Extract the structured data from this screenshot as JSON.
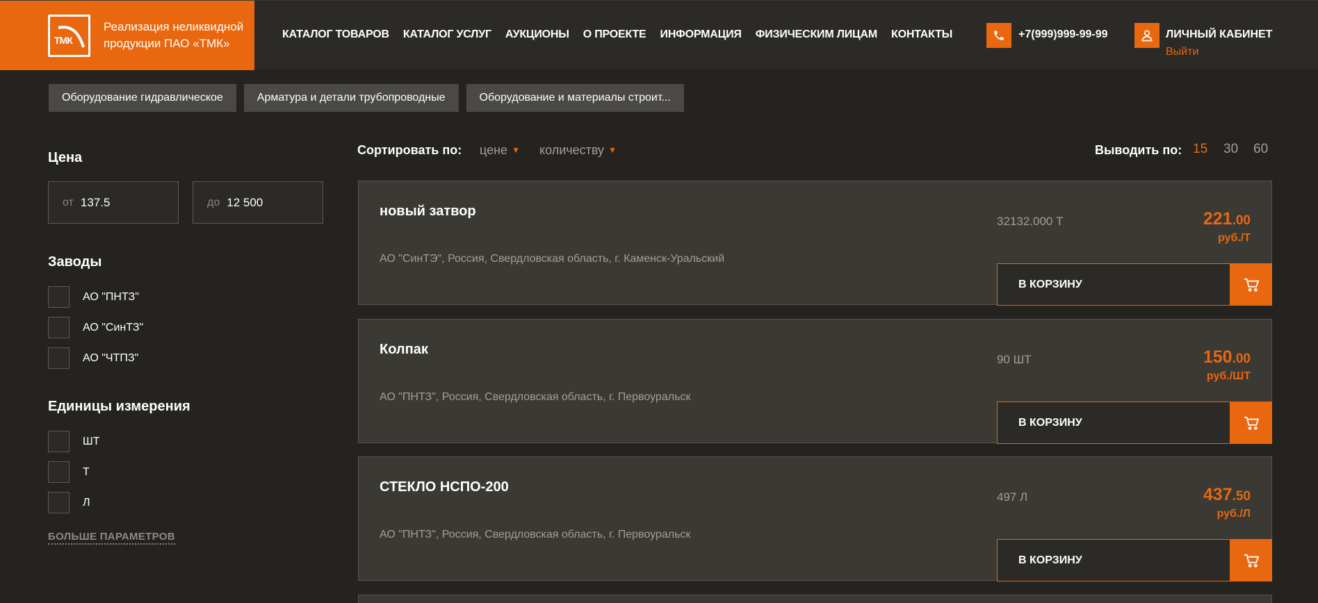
{
  "header": {
    "logo_letters": "ТМК",
    "logo_text": "Реализация неликвидной продукции ПАО «ТМК»",
    "nav": [
      "КАТАЛОГ ТОВАРОВ",
      "КАТАЛОГ УСЛУГ",
      "АУКЦИОНЫ",
      "О ПРОЕКТЕ",
      "ИНФОРМАЦИЯ",
      "ФИЗИЧЕСКИМ ЛИЦАМ",
      "КОНТАКТЫ"
    ],
    "phone": "+7(999)999-99-99",
    "cabinet_label": "ЛИЧНЫЙ КАБИНЕТ",
    "logout_label": "Выйти",
    "phone_icon": "phone-icon",
    "user_icon": "user-icon"
  },
  "chips": [
    "Оборудование гидравлическое",
    "Арматура и детали трубопроводные",
    "Оборудование и материалы строит..."
  ],
  "sidebar": {
    "price": {
      "title": "Цена",
      "from_prefix": "от",
      "from_value": "137.5",
      "to_prefix": "до",
      "to_value": "12 500"
    },
    "plants": {
      "title": "Заводы",
      "items": [
        "АО \"ПНТЗ\"",
        "АО \"СинТЗ\"",
        "АО \"ЧТПЗ\""
      ]
    },
    "units": {
      "title": "Единицы измерения",
      "items": [
        "ШТ",
        "Т",
        "Л"
      ]
    },
    "more_label": "БОЛЬШЕ ПАРАМЕТРОВ"
  },
  "sort": {
    "label": "Сортировать по:",
    "options": [
      "цене",
      "количеству"
    ],
    "arrow": "▼"
  },
  "per_page": {
    "label": "Выводить по:",
    "options": [
      "15",
      "30",
      "60"
    ],
    "active": "15"
  },
  "products": [
    {
      "title": "новый затвор",
      "location": "АО \"СинТЭ\", Россия, Свердловская область, г. Каменск-Уральский",
      "quantity": "32132.000 Т",
      "price_int": "221",
      "price_dec": ".00",
      "price_unit": "руб./Т",
      "cart_label": "В КОРЗИНУ"
    },
    {
      "title": "Колпак",
      "location": "АО \"ПНТЗ\", Россия, Свердловская область, г. Первоуральск",
      "quantity": "90 ШТ",
      "price_int": "150",
      "price_dec": ".00",
      "price_unit": "руб./ШТ",
      "cart_label": "В КОРЗИНУ"
    },
    {
      "title": "СТЕКЛО НСПО-200",
      "location": "АО \"ПНТЗ\", Россия, Свердловская область, г. Первоуральск",
      "quantity": "497 Л",
      "price_int": "437",
      "price_dec": ".50",
      "price_unit": "руб./Л",
      "cart_label": "В КОРЗИНУ"
    }
  ],
  "colors": {
    "accent": "#e8670f",
    "background": "#242320",
    "card": "#3a3934"
  }
}
